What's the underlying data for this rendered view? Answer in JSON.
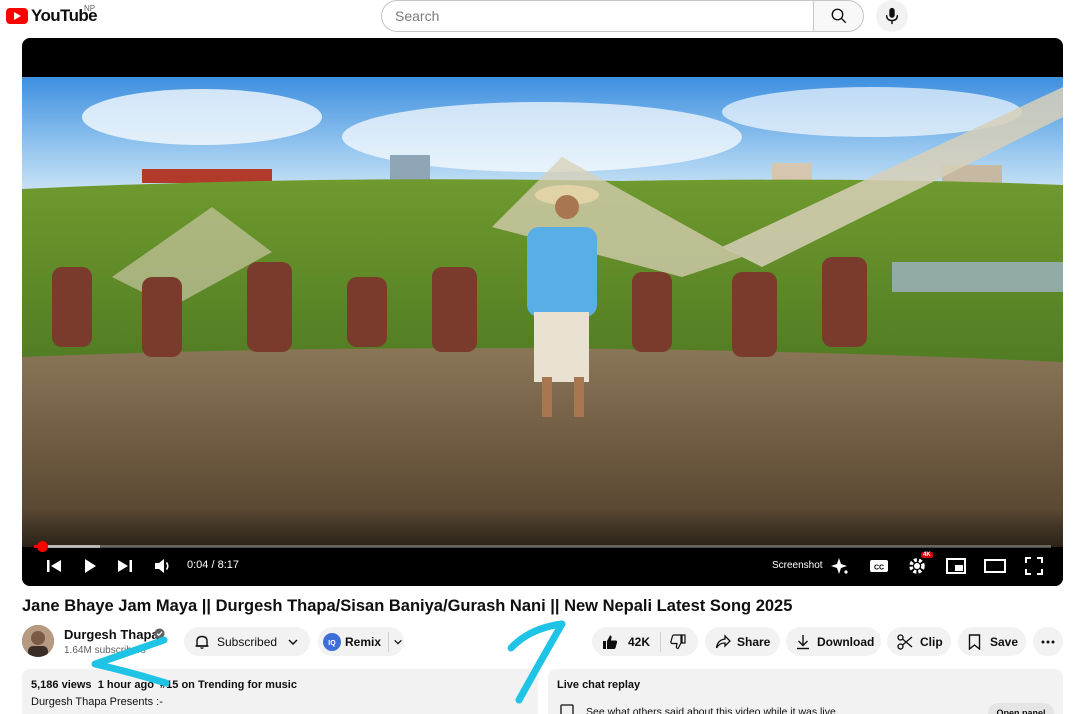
{
  "header": {
    "logo_text": "YouTube",
    "country_code": "NP",
    "search_placeholder": "Search",
    "search_icon": "search-icon",
    "mic_icon": "microphone-icon"
  },
  "player": {
    "time_current": "0:04",
    "time_total": "8:17",
    "time_display": "0:04 / 8:17",
    "progress_fraction": 0.008,
    "buffer_fraction": 0.065,
    "screenshot_label": "Screenshot",
    "quality_badge": "4K",
    "icons": [
      "previous-icon",
      "play-icon",
      "next-icon",
      "volume-icon",
      "ai-sparkle-icon",
      "captions-icon",
      "settings-icon",
      "miniplayer-icon",
      "theater-mode-icon",
      "fullscreen-icon"
    ]
  },
  "video": {
    "title": "Jane Bhaye Jam Maya || Durgesh Thapa/Sisan Baniya/Gurash Nani || New Nepali Latest Song 2025"
  },
  "channel": {
    "name": "Durgesh Thapa",
    "subscribers": "1.64M subscribers",
    "subscribe_label": "Subscribed",
    "remix_label": "Remix"
  },
  "actions": {
    "likes": "42K",
    "share_label": "Share",
    "download_label": "Download",
    "clip_label": "Clip",
    "save_label": "Save"
  },
  "description": {
    "views": "5,186 views",
    "age": "1 hour ago",
    "trending": "#15 on Trending for music",
    "first_line": "Durgesh Thapa Presents :-"
  },
  "chat": {
    "title": "Live chat replay",
    "hint": "See what others said about this video while it was live.",
    "open_panel_label": "Open panel"
  },
  "colors": {
    "brand_red": "#ff0000",
    "annotation_cyan": "#1ec3e6",
    "pill_bg": "#f2f2f2"
  }
}
